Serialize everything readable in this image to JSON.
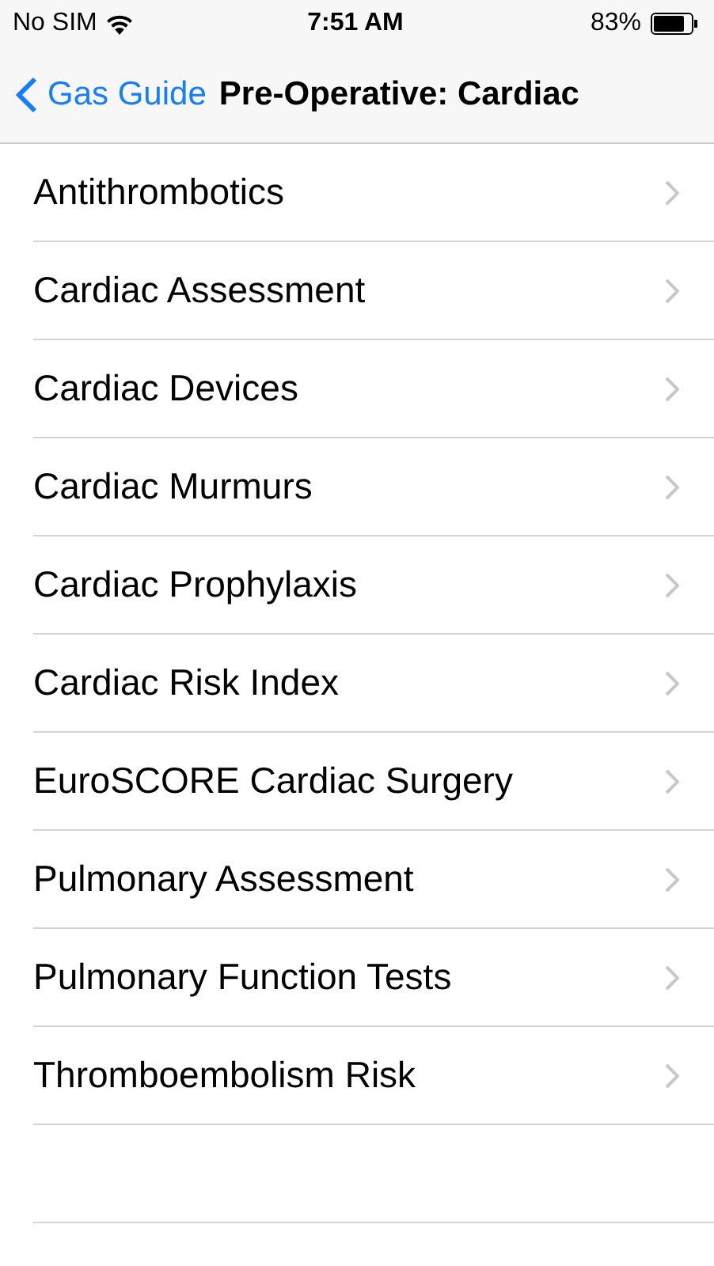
{
  "status_bar": {
    "carrier": "No SIM",
    "time": "7:51 AM",
    "battery": "83%"
  },
  "nav_bar": {
    "back": "Gas Guide",
    "title": "Pre-Operative: Cardiac"
  },
  "items": [
    {
      "label": "Antithrombotics"
    },
    {
      "label": "Cardiac Assessment"
    },
    {
      "label": "Cardiac Devices"
    },
    {
      "label": "Cardiac Murmurs"
    },
    {
      "label": "Cardiac Prophylaxis"
    },
    {
      "label": "Cardiac Risk Index"
    },
    {
      "label": "EuroSCORE Cardiac Surgery"
    },
    {
      "label": "Pulmonary Assessment"
    },
    {
      "label": "Pulmonary Function Tests"
    },
    {
      "label": "Thromboembolism Risk"
    }
  ]
}
